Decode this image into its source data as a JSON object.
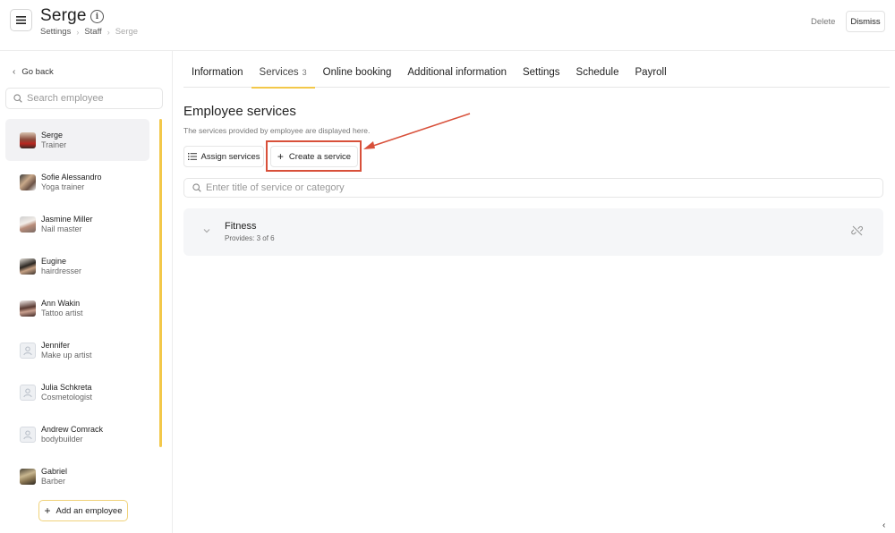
{
  "header": {
    "title": "Serge",
    "breadcrumb": [
      "Settings",
      "Staff",
      "Serge"
    ],
    "delete_label": "Delete",
    "dismiss_label": "Dismiss"
  },
  "sidebar": {
    "go_back": "Go back",
    "search_placeholder": "Search employee",
    "employees": [
      {
        "name": "Serge",
        "role": "Trainer",
        "active": true
      },
      {
        "name": "Sofie Alessandro",
        "role": "Yoga trainer"
      },
      {
        "name": "Jasmine Miller",
        "role": "Nail master"
      },
      {
        "name": "Eugine",
        "role": "hairdresser"
      },
      {
        "name": "Ann Wakin",
        "role": "Tattoo artist"
      },
      {
        "name": "Jennifer",
        "role": "Make up artist"
      },
      {
        "name": "Julia Schkreta",
        "role": "Cosmetologist"
      },
      {
        "name": "Andrew Comrack",
        "role": "bodybuilder"
      },
      {
        "name": "Gabriel",
        "role": "Barber"
      }
    ],
    "add_employee_label": "Add an employee"
  },
  "tabs": [
    {
      "label": "Information"
    },
    {
      "label": "Services",
      "count": "3",
      "active": true
    },
    {
      "label": "Online booking"
    },
    {
      "label": "Additional information"
    },
    {
      "label": "Settings"
    },
    {
      "label": "Schedule"
    },
    {
      "label": "Payroll"
    }
  ],
  "main": {
    "section_title": "Employee services",
    "section_desc": "The services provided by employee are displayed here.",
    "assign_label": "Assign services",
    "create_label": "Create a service",
    "service_search_placeholder": "Enter title of service or category",
    "categories": [
      {
        "name": "Fitness",
        "provides": "Provides: 3 of 6"
      }
    ]
  },
  "colors": {
    "accent": "#f3c84a",
    "annotation": "#d8503a"
  }
}
